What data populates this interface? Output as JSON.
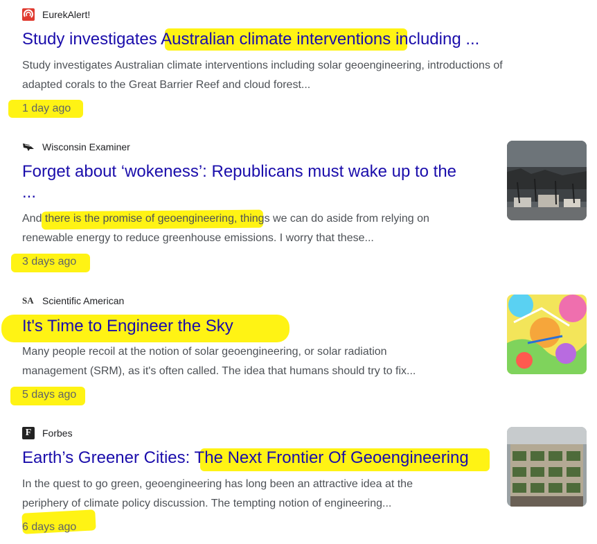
{
  "results": [
    {
      "source": "EurekAlert!",
      "source_icon": "eurekalert-logo-icon",
      "title": "Study investigates Australian climate interventions including ...",
      "snippet_lines": [
        "Study investigates Australian climate interventions including solar geoengineering, introductions of",
        "adapted corals to the Great Barrier Reef and cloud forest..."
      ],
      "time": "1 day ago"
    },
    {
      "source": "Wisconsin Examiner",
      "source_icon": "wisconsin-examiner-logo-icon",
      "title_lines": [
        "Forget about ‘wokeness’: Republicans must wake up to the",
        "..."
      ],
      "snippet_lines": [
        "And there is the promise of geoengineering, things we can do aside from relying on",
        "renewable energy to reduce greenhouse emissions. I worry that these..."
      ],
      "time": "3 days ago",
      "thumbnail": "burned-town-photo"
    },
    {
      "source": "Scientific American",
      "source_icon_text": "SA",
      "title": "It's Time to Engineer the Sky",
      "snippet_lines": [
        "Many people recoil at the notion of solar geoengineering, or solar radiation",
        "management (SRM), as it's often called. The idea that humans should try to fix..."
      ],
      "time": "5 days ago",
      "thumbnail": "colorful-illustration"
    },
    {
      "source": "Forbes",
      "source_icon_text": "F",
      "title": "Earth’s Greener Cities: The Next Frontier Of Geoengineering",
      "snippet_lines": [
        "In the quest to go green, geoengineering has long been an attractive idea at the",
        "periphery of climate policy discussion. The tempting notion of engineering..."
      ],
      "time": "6 days ago",
      "thumbnail": "green-building-photo"
    }
  ],
  "colors": {
    "title": "#1a0dab",
    "snippet": "#4d5156",
    "highlight": "#fff200"
  }
}
